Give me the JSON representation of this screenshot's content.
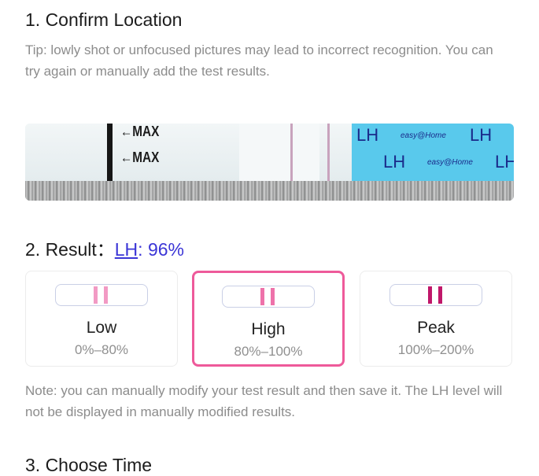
{
  "section1": {
    "title": "1. Confirm Location",
    "tip": "Tip: lowly shot or unfocused pictures may lead to incorrect recognition. You can try again or manually add the test results."
  },
  "strip": {
    "max_label_1": "←MAX",
    "max_label_2": "←MAX",
    "lh_text_1": "LH",
    "lh_text_2": "LH",
    "lh_text_3": "LH",
    "lh_text_4": "LH",
    "brand_1": "easy@Home",
    "brand_2": "easy@Home"
  },
  "section2": {
    "title_prefix": "2. Result：",
    "lh_link": "LH",
    "lh_value": ": 96%"
  },
  "result_options": [
    {
      "name": "Low",
      "range": "0%–80%",
      "selected": false,
      "line_color": "#f29ac4"
    },
    {
      "name": "High",
      "range": "80%–100%",
      "selected": true,
      "line_color": "#ee72aa"
    },
    {
      "name": "Peak",
      "range": "100%–200%",
      "selected": false,
      "line_color": "#c0176a"
    }
  ],
  "note": "Note: you can manually modify your test result and then save it. The LH level will not be displayed in manually modified results.",
  "section3": {
    "title": "3. Choose Time"
  },
  "colors": {
    "accent": "#3b35d6",
    "selected_border": "#ee5a9a",
    "muted_text": "#8c8c8c"
  }
}
